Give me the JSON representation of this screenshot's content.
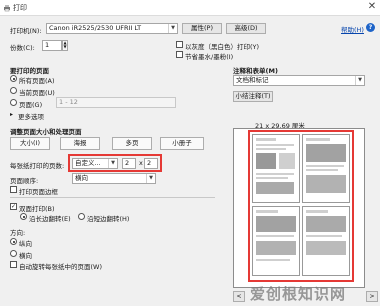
{
  "window": {
    "title": "打印"
  },
  "printer": {
    "label": "打印机(N):",
    "value": "Canon iR2525/2530 UFRII LT",
    "properties_btn": "属性(P)",
    "advanced_btn": "高级(D)",
    "help_link": "帮助(H)"
  },
  "copies": {
    "label": "份数(C):",
    "value": "1"
  },
  "options": {
    "grayscale": "以灰度（黑白色）打印(Y)",
    "save_ink": "节省墨水/墨粉(I)"
  },
  "pages_to_print": {
    "heading": "要打印的页面",
    "all": "所有页面(A)",
    "current": "当前页面(U)",
    "pages": "页面(G)",
    "pages_placeholder": "1 - 12",
    "more": "更多选项"
  },
  "comments": {
    "heading": "注释和表单(M)",
    "value": "文档和标记",
    "summary_btn": "小结注释(T)"
  },
  "sizing": {
    "heading": "调整页面大小和处理页面",
    "tabs": [
      "大小(I)",
      "海报",
      "多页",
      "小册子"
    ],
    "pages_per_sheet_label": "每张纸打印的页数:",
    "pages_per_sheet_value": "自定义...",
    "cols": "2",
    "times": "x",
    "rows": "2",
    "order_label": "页面顺序:",
    "order_value": "横向",
    "print_border": "打印页面边框"
  },
  "duplex": {
    "label": "双面打印(B)",
    "long_edge": "沿长边翻转(E)",
    "short_edge": "沿短边翻转(H)"
  },
  "orientation": {
    "label": "方向:",
    "portrait": "纵向",
    "landscape": "横向",
    "auto_rotate": "自动旋转每张纸中的页面(W)"
  },
  "preview": {
    "size_text": "21 x 29.69 厘米",
    "prev": "<",
    "next": ">"
  },
  "watermark": {
    "text": "爱创根知识网"
  }
}
